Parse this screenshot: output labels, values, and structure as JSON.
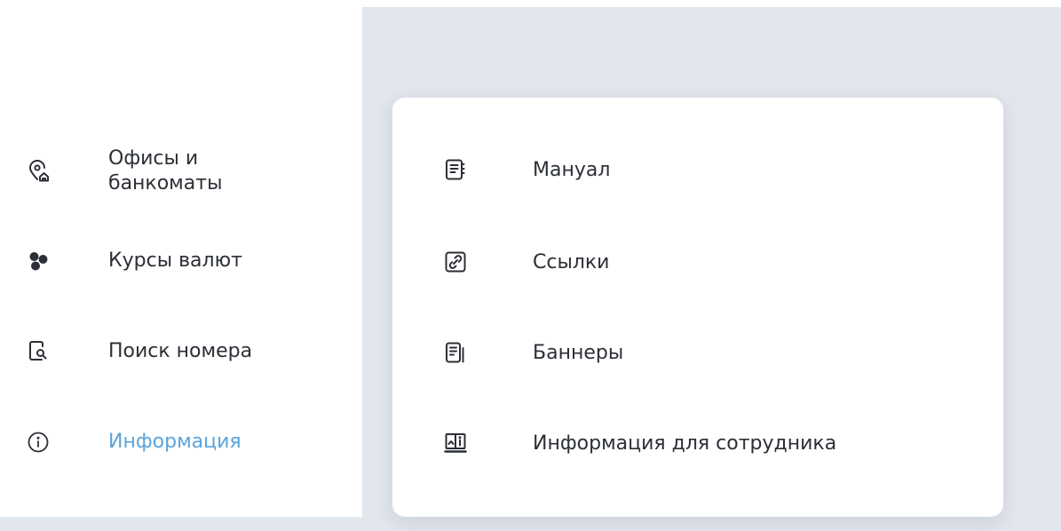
{
  "sidebar": {
    "items": [
      {
        "label": "Офисы и банкоматы",
        "icon": "location-home-icon"
      },
      {
        "label": "Курсы валют",
        "icon": "currency-exchange-icon"
      },
      {
        "label": "Поиск номера",
        "icon": "phone-search-icon"
      },
      {
        "label": "Информация",
        "icon": "info-icon",
        "active": true
      }
    ]
  },
  "submenu": {
    "items": [
      {
        "label": "Мануал",
        "icon": "manual-icon"
      },
      {
        "label": "Ссылки",
        "icon": "link-icon"
      },
      {
        "label": "Баннеры",
        "icon": "banners-icon"
      },
      {
        "label": "Информация для сотрудника",
        "icon": "employee-info-book-icon"
      }
    ]
  },
  "colors": {
    "accent": "#5ba3d9",
    "text": "#2b2f36",
    "background": "#e2e6ed"
  }
}
